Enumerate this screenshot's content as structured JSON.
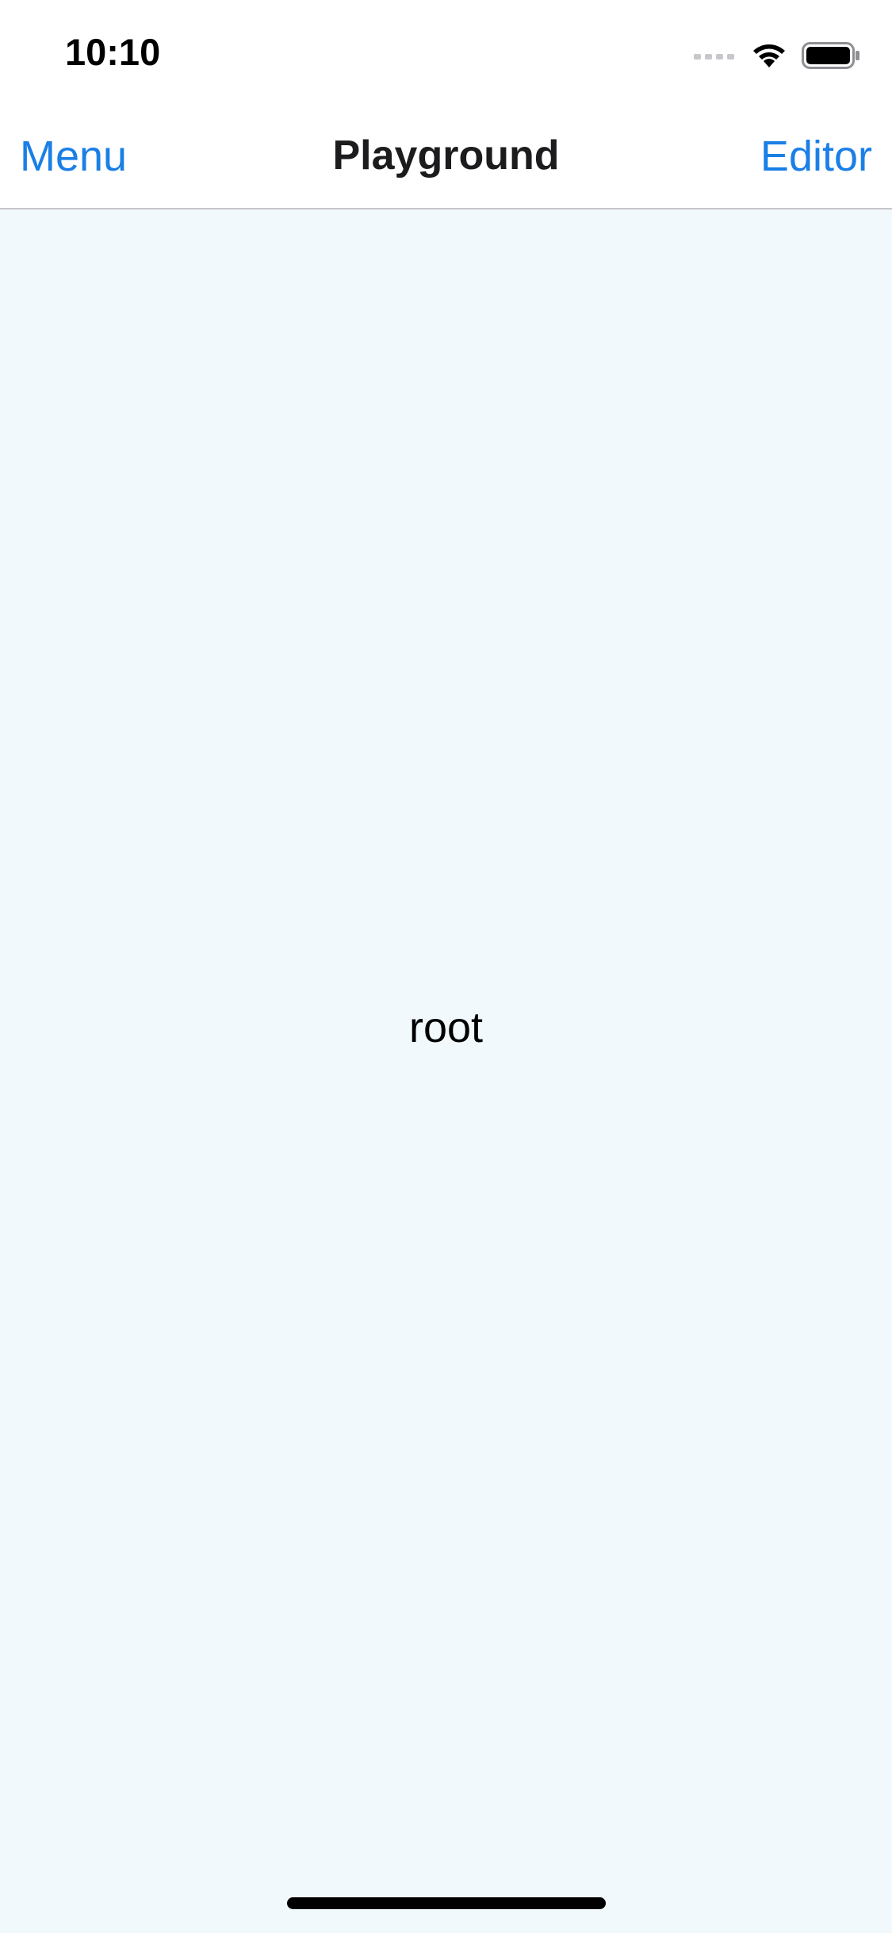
{
  "status_bar": {
    "time": "10:10",
    "signal_icon": "cellular-signal-icon",
    "wifi_icon": "wifi-icon",
    "battery_icon": "battery-icon"
  },
  "nav": {
    "left_label": "Menu",
    "title": "Playground",
    "right_label": "Editor"
  },
  "content": {
    "label": "root"
  },
  "colors": {
    "accent": "#1a7fe6",
    "content_background": "#f2f9fd",
    "nav_background": "#ffffff"
  }
}
